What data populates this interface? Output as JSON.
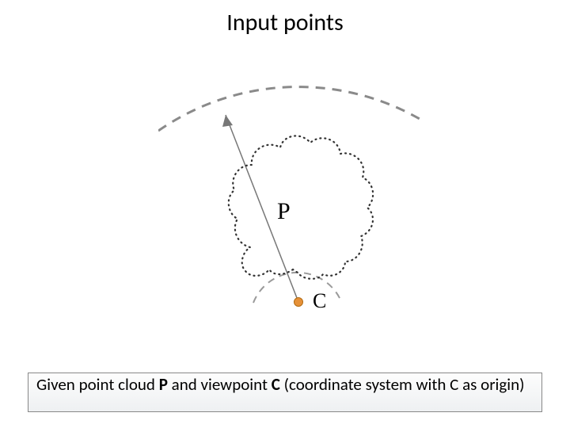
{
  "title": "Input points",
  "labels": {
    "P": "P",
    "C": "C"
  },
  "caption": {
    "prefix": "Given point cloud ",
    "P": "P",
    "mid": " and viewpoint ",
    "C": "C",
    "suffix": " (coordinate system with C as origin)"
  },
  "diagram": {
    "viewpoint": {
      "name": "C",
      "role": "origin"
    },
    "pointcloud": {
      "name": "P",
      "shape": "bear-like dotted outline"
    },
    "arcs": "two concentric dashed arcs centered at C",
    "arrow": "radial arrow from C through P to outer arc"
  }
}
